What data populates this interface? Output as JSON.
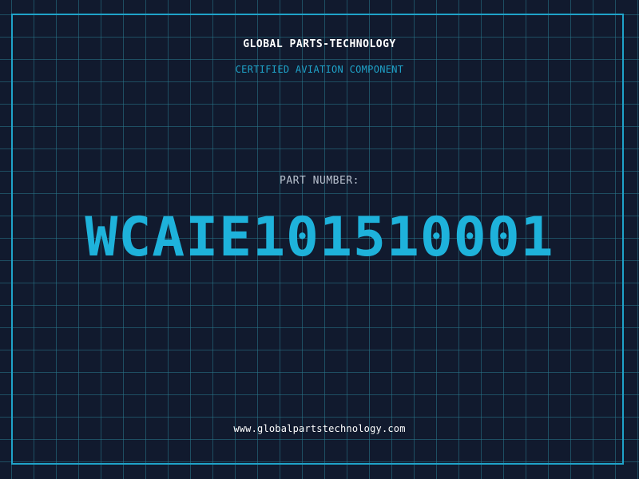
{
  "header": {
    "company": "GLOBAL PARTS-TECHNOLOGY",
    "tagline": "CERTIFIED AVIATION COMPONENT"
  },
  "part": {
    "label": "PART NUMBER:",
    "number": "WCAIE101510001"
  },
  "footer": {
    "website": "www.globalpartstechnology.com"
  },
  "colors": {
    "background": "#111a2e",
    "accent": "#1fa3c9",
    "text": "#ffffff",
    "muted": "#b9c2cf"
  }
}
